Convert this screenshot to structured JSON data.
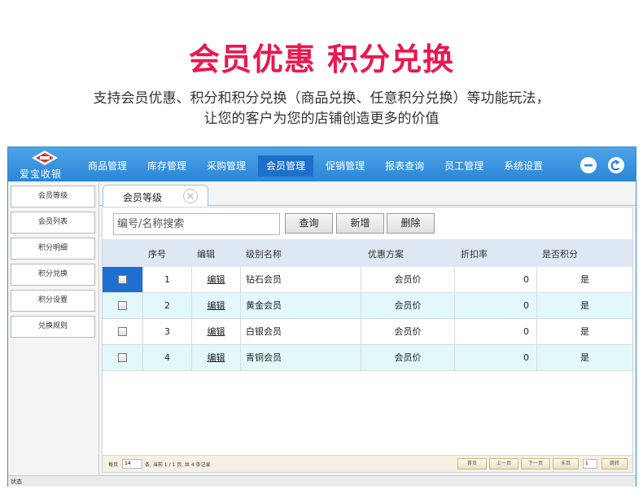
{
  "promo": {
    "title": "会员优惠 积分兑换",
    "subtitle_line1": "支持会员优惠、积分和积分兑换（商品兑换、任意积分兑换）等功能玩法，",
    "subtitle_line2": "让您的客户为您的店铺创造更多的价值"
  },
  "app": {
    "logo_text": "爱宝收银",
    "nav": [
      "商品管理",
      "库存管理",
      "采购管理",
      "会员管理",
      "促销管理",
      "报表查询",
      "员工管理",
      "系统设置"
    ],
    "active_nav": "会员管理",
    "sidebar": [
      "会员等级",
      "会员列表",
      "积分明细",
      "积分兑换",
      "积分设置",
      "兑换规则"
    ],
    "tab": {
      "label": "会员等级"
    },
    "toolbar": {
      "search_placeholder": "编号/名称搜索",
      "query": "查询",
      "add": "新增",
      "delete": "删除"
    },
    "table": {
      "headers": [
        "序号",
        "编辑",
        "级别名称",
        "优惠方案",
        "折扣率",
        "是否积分"
      ],
      "rows": [
        {
          "no": "1",
          "edit": "编辑",
          "name": "钻石会员",
          "plan": "会员价",
          "discount": "0",
          "points": "是"
        },
        {
          "no": "2",
          "edit": "编辑",
          "name": "黄金会员",
          "plan": "会员价",
          "discount": "0",
          "points": "是"
        },
        {
          "no": "3",
          "edit": "编辑",
          "name": "白银会员",
          "plan": "会员价",
          "discount": "0",
          "points": "是"
        },
        {
          "no": "4",
          "edit": "编辑",
          "name": "青铜会员",
          "plan": "会员价",
          "discount": "0",
          "points": "是"
        }
      ]
    },
    "pager": {
      "per_page_label": "每页",
      "per_page": "14",
      "info": "条, 当前 1 / 1 页, 共 4 条记录",
      "first": "首页",
      "prev": "上一页",
      "next": "下一页",
      "last": "末页",
      "page_input": "1",
      "jump": "跳转"
    },
    "status": "状态"
  },
  "colors": {
    "title_red": "#e8194f",
    "topbar_blue": "#2a86d8",
    "selected_cell": "#1e6fd0",
    "row_alt": "#e3f8fb"
  }
}
